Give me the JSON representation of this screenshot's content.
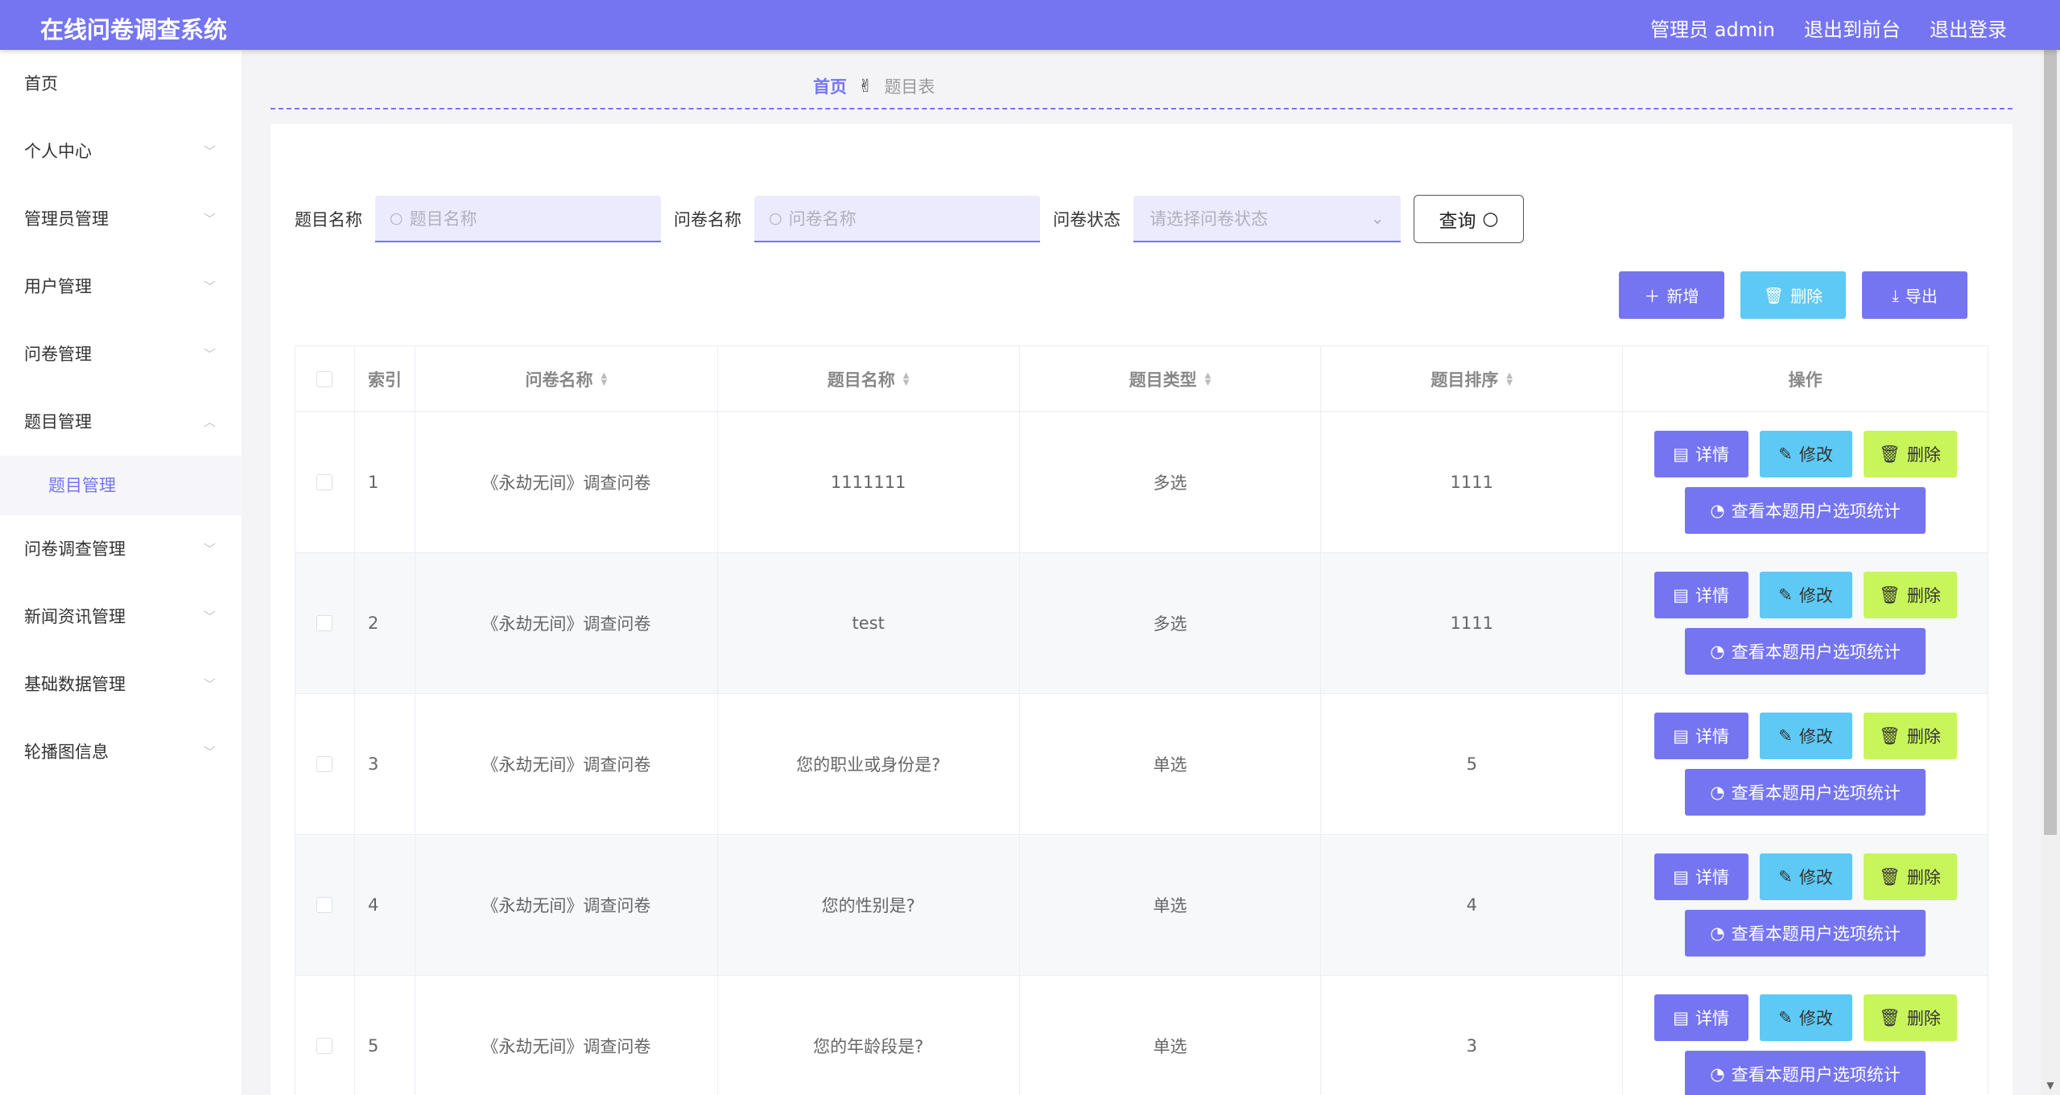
{
  "header": {
    "title": "在线问卷调查系统",
    "admin_label": "管理员 admin",
    "front_link": "退出到前台",
    "logout_link": "退出登录"
  },
  "sidebar": {
    "items": [
      {
        "label": "首页",
        "has_chevron": false
      },
      {
        "label": "个人中心",
        "has_chevron": true
      },
      {
        "label": "管理员管理",
        "has_chevron": true
      },
      {
        "label": "用户管理",
        "has_chevron": true
      },
      {
        "label": "问卷管理",
        "has_chevron": true
      },
      {
        "label": "题目管理",
        "has_chevron": true,
        "expanded": true
      },
      {
        "label": "问卷调查管理",
        "has_chevron": true
      },
      {
        "label": "新闻资讯管理",
        "has_chevron": true
      },
      {
        "label": "基础数据管理",
        "has_chevron": true
      },
      {
        "label": "轮播图信息",
        "has_chevron": true
      }
    ],
    "subitem": "题目管理"
  },
  "breadcrumb": {
    "home": "首页",
    "current": "题目表"
  },
  "search": {
    "label1": "题目名称",
    "placeholder1": "题目名称",
    "label2": "问卷名称",
    "placeholder2": "问卷名称",
    "label3": "问卷状态",
    "placeholder3": "请选择问卷状态",
    "query_label": "查询"
  },
  "actions": {
    "add": "新增",
    "delete": "删除",
    "export": "导出"
  },
  "table": {
    "headers": {
      "index": "索引",
      "questionnaire": "问卷名称",
      "topic": "题目名称",
      "type": "题目类型",
      "sort": "题目排序",
      "ops": "操作"
    },
    "rows": [
      {
        "index": "1",
        "questionnaire": "《永劫无间》调查问卷",
        "topic": "1111111",
        "type": "多选",
        "sort": "1111"
      },
      {
        "index": "2",
        "questionnaire": "《永劫无间》调查问卷",
        "topic": "test",
        "type": "多选",
        "sort": "1111"
      },
      {
        "index": "3",
        "questionnaire": "《永劫无间》调查问卷",
        "topic": "您的职业或身份是?",
        "type": "单选",
        "sort": "5"
      },
      {
        "index": "4",
        "questionnaire": "《永劫无间》调查问卷",
        "topic": "您的性别是?",
        "type": "单选",
        "sort": "4"
      },
      {
        "index": "5",
        "questionnaire": "《永劫无间》调查问卷",
        "topic": "您的年龄段是?",
        "type": "单选",
        "sort": "3"
      }
    ],
    "row_buttons": {
      "detail": "详情",
      "edit": "修改",
      "remove": "删除",
      "stats": "查看本题用户选项统计"
    }
  },
  "colors": {
    "primary": "#7575f2",
    "info": "#5ec9f5",
    "lime": "#c8f55a"
  }
}
